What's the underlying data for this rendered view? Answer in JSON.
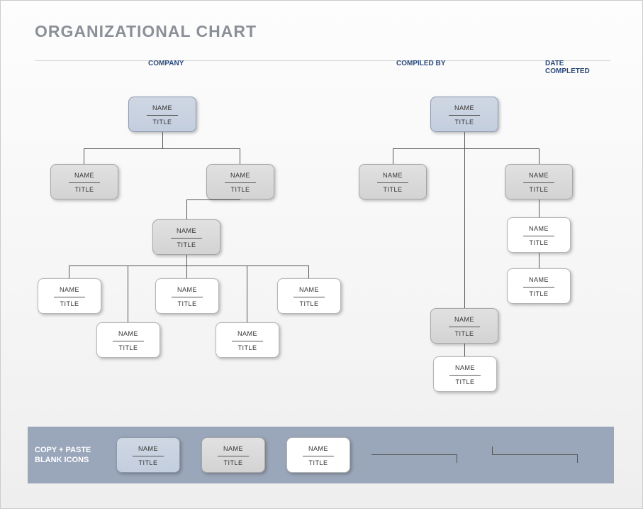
{
  "title": "ORGANIZATIONAL CHART",
  "header": {
    "company": "COMPANY",
    "compiled_by": "COMPILED BY",
    "date_completed": "DATE COMPLETED"
  },
  "node_text": {
    "name": "NAME",
    "title": "TITLE"
  },
  "footer_label_l1": "COPY + PASTE",
  "footer_label_l2": "BLANK ICONS"
}
